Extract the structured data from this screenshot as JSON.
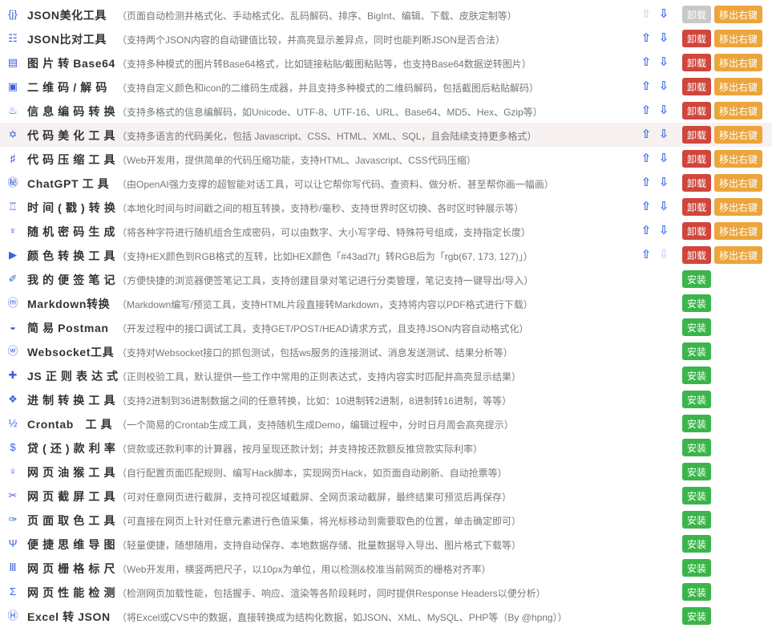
{
  "colors": {
    "icon": "#3b5fe0",
    "arrow": "#3b6ef0",
    "uninstall": "#d0463c",
    "move": "#eba53c",
    "install": "#3bb54a",
    "highlight_row": "#f7f1f1"
  },
  "tools": [
    {
      "icon": "json-icon",
      "glyph": "{j}",
      "name": "JSON美化工具",
      "desc": "（页面自动检测并格式化、手动格式化、乱码解码、排序、BigInt、编辑、下载、皮肤定制等）",
      "installed": true,
      "up_enabled": false,
      "down_enabled": true,
      "uninstall_disabled": true,
      "uninstall_label": "卸载",
      "move_label": "移出右键"
    },
    {
      "icon": "compare-icon",
      "glyph": "☷",
      "name": "JSON比对工具",
      "desc": "（支持两个JSON内容的自动键值比较，并高亮显示差异点，同时也能判断JSON是否合法）",
      "installed": true,
      "up_enabled": true,
      "down_enabled": true,
      "uninstall_label": "卸载",
      "move_label": "移出右键"
    },
    {
      "icon": "image-icon",
      "glyph": "▤",
      "name": "图 片 转 Base64",
      "desc": "（支持多种模式的图片转Base64格式，比如链接粘贴/截图粘贴等，也支持Base64数据逆转图片）",
      "installed": true,
      "up_enabled": true,
      "down_enabled": true,
      "uninstall_label": "卸载",
      "move_label": "移出右键"
    },
    {
      "icon": "qrcode-icon",
      "glyph": "▣",
      "name": "二 维 码 / 解 码",
      "desc": "（支持自定义颜色和icon的二维码生成器，并且支持多种模式的二维码解码，包括截图后粘贴解码）",
      "installed": true,
      "up_enabled": true,
      "down_enabled": true,
      "uninstall_label": "卸载",
      "move_label": "移出右键"
    },
    {
      "icon": "encode-icon",
      "glyph": "♨",
      "name": "信 息 编 码 转 换",
      "desc": "（支持多格式的信息编解码，如Unicode、UTF-8、UTF-16、URL、Base64、MD5、Hex、Gzip等）",
      "installed": true,
      "up_enabled": true,
      "down_enabled": true,
      "uninstall_label": "卸载",
      "move_label": "移出右键"
    },
    {
      "icon": "code-beautify-icon",
      "glyph": "✡",
      "name": "代 码 美 化 工 具",
      "desc": "（支持多语言的代码美化，包括 Javascript、CSS、HTML、XML、SQL，且会陆续支持更多格式）",
      "installed": true,
      "up_enabled": true,
      "down_enabled": true,
      "highlight": true,
      "uninstall_label": "卸载",
      "move_label": "移出右键"
    },
    {
      "icon": "compress-icon",
      "glyph": "♯",
      "name": "代 码 压 缩 工 具",
      "desc": "（Web开发用，提供简单的代码压缩功能，支持HTML、Javascript、CSS代码压缩）",
      "installed": true,
      "up_enabled": true,
      "down_enabled": true,
      "uninstall_label": "卸载",
      "move_label": "移出右键"
    },
    {
      "icon": "chatgpt-icon",
      "glyph": "㊙",
      "name": "ChatGPT 工 具",
      "desc": "（由OpenAI强力支撑的超智能对话工具，可以让它帮你写代码、查资料、做分析、甚至帮你画一幅画）",
      "installed": true,
      "up_enabled": true,
      "down_enabled": true,
      "uninstall_label": "卸载",
      "move_label": "移出右键"
    },
    {
      "icon": "timestamp-icon",
      "glyph": "♖",
      "name": "时 间 ( 戳 ) 转 换",
      "desc": "（本地化时间与时间戳之间的相互转换，支持秒/毫秒、支持世界时区切换、各时区时钟展示等）",
      "installed": true,
      "up_enabled": true,
      "down_enabled": true,
      "uninstall_label": "卸载",
      "move_label": "移出右键"
    },
    {
      "icon": "password-icon",
      "glyph": "♆",
      "name": "随 机 密 码 生 成",
      "desc": "（将各种字符进行随机组合生成密码，可以由数字、大小写字母、特殊符号组成，支持指定长度）",
      "installed": true,
      "up_enabled": true,
      "down_enabled": true,
      "uninstall_label": "卸载",
      "move_label": "移出右键"
    },
    {
      "icon": "color-icon",
      "glyph": "▶",
      "name": "颜 色 转 换 工 具",
      "desc": "（支持HEX颜色到RGB格式的互转，比如HEX颜色「#43ad7f」转RGB后为「rgb(67, 173, 127)」）",
      "installed": true,
      "up_enabled": true,
      "down_enabled": false,
      "uninstall_label": "卸载",
      "move_label": "移出右键"
    },
    {
      "icon": "note-icon",
      "glyph": "✐",
      "name": "我 的 便 签 笔 记",
      "desc": "（方便快捷的浏览器便签笔记工具，支持创建目录对笔记进行分类管理，笔记支持一键导出/导入）",
      "installed": false,
      "install_label": "安装"
    },
    {
      "icon": "markdown-icon",
      "glyph": "ⓜ",
      "name": "Markdown转换",
      "desc": "（Markdown编写/预览工具，支持HTML片段直接转Markdown，支持将内容以PDF格式进行下载）",
      "installed": false,
      "install_label": "安装"
    },
    {
      "icon": "postman-icon",
      "glyph": "◒",
      "name": "简 易 Postman",
      "desc": "（开发过程中的接口调试工具，支持GET/POST/HEAD请求方式，且支持JSON内容自动格式化）",
      "installed": false,
      "install_label": "安装"
    },
    {
      "icon": "websocket-icon",
      "glyph": "ⓦ",
      "name": "Websocket工具",
      "desc": "（支持对Websocket接口的抓包测试，包括ws服务的连接测试、消息发送测试、结果分析等）",
      "installed": false,
      "install_label": "安装"
    },
    {
      "icon": "regex-icon",
      "glyph": "✚",
      "name": "JS 正 则 表 达 式",
      "desc": "（正则校验工具，默认提供一些工作中常用的正则表达式，支持内容实时匹配并高亮显示结果）",
      "installed": false,
      "install_label": "安装"
    },
    {
      "icon": "radix-icon",
      "glyph": "❖",
      "name": "进 制 转 换 工 具",
      "desc": "（支持2进制到36进制数据之间的任意转换，比如：10进制转2进制，8进制转16进制，等等）",
      "installed": false,
      "install_label": "安装"
    },
    {
      "icon": "crontab-icon",
      "glyph": "½",
      "name": "Crontab　工 具",
      "desc": "（一个简易的Crontab生成工具，支持随机生成Demo，编辑过程中，分时日月周会高亮提示）",
      "installed": false,
      "install_label": "安装"
    },
    {
      "icon": "loan-icon",
      "glyph": "$",
      "name": "贷 ( 还 ) 款 利 率",
      "desc": "（贷款或还款利率的计算器，按月呈现还款计划；并支持按还款额反推贷款实际利率）",
      "installed": false,
      "install_label": "安装"
    },
    {
      "icon": "grease-icon",
      "glyph": "♀",
      "name": "网 页 油 猴 工 具",
      "desc": "（自行配置页面匹配规则、编写Hack脚本，实现网页Hack，如页面自动刷新、自动抢票等）",
      "installed": false,
      "install_label": "安装"
    },
    {
      "icon": "screenshot-icon",
      "glyph": "✂",
      "name": "网 页 截 屏 工 具",
      "desc": "（可对任意网页进行截屏，支持可视区域截屏、全网页滚动截屏，最终结果可预览后再保存）",
      "installed": false,
      "install_label": "安装"
    },
    {
      "icon": "color-picker-icon",
      "glyph": "✑",
      "name": "页 面 取 色 工 具",
      "desc": "（可直接在网页上针对任意元素进行色值采集，将光标移动到需要取色的位置，单击确定即可）",
      "installed": false,
      "install_label": "安装"
    },
    {
      "icon": "mindmap-icon",
      "glyph": "Ψ",
      "name": "便 捷 思 维 导 图",
      "desc": "（轻量便捷，随想随用，支持自动保存、本地数据存储、批量数据导入导出、图片格式下载等）",
      "installed": false,
      "install_label": "安装"
    },
    {
      "icon": "grid-ruler-icon",
      "glyph": "Ⅲ",
      "name": "网 页 栅 格 标 尺",
      "desc": "（Web开发用，横竖两把尺子，以10px为单位，用以检测&校准当前网页的栅格对齐率）",
      "installed": false,
      "install_label": "安装"
    },
    {
      "icon": "performance-icon",
      "glyph": "Σ",
      "name": "网 页 性 能 检 测",
      "desc": "（检测网页加载性能，包括握手、响应、渲染等各阶段耗时，同时提供Response Headers以便分析）",
      "installed": false,
      "install_label": "安装"
    },
    {
      "icon": "excel-icon",
      "glyph": "Ⓗ",
      "name": "Excel 转 JSON",
      "desc": "（将Excel或CVS中的数据，直接转换成为结构化数据，如JSON、XML、MySQL、PHP等（By @hpng））",
      "installed": false,
      "install_label": "安装"
    }
  ]
}
